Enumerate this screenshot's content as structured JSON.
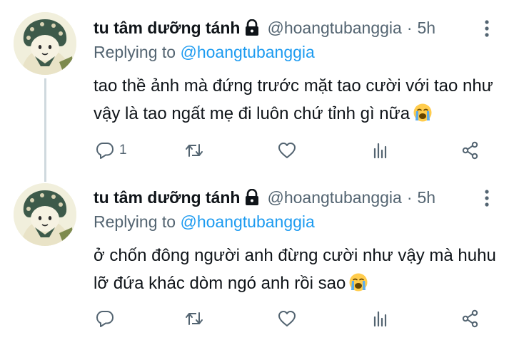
{
  "tweets": [
    {
      "display_name": "tu tâm dưỡng tánh",
      "handle": "@hoangtubanggia",
      "separator": "·",
      "time": "5h",
      "replying_prefix": "Replying to",
      "replying_handle": "@hoangtubanggia",
      "text": "tao thề ảnh mà đứng trước mặt tao cười với tao như vậy là tao ngất mẹ đi luôn chứ tỉnh gì nữa",
      "emoji": "loudly-crying-face",
      "reply_count": "1"
    },
    {
      "display_name": "tu tâm dưỡng tánh",
      "handle": "@hoangtubanggia",
      "separator": "·",
      "time": "5h",
      "replying_prefix": "Replying to",
      "replying_handle": "@hoangtubanggia",
      "text": "ở chốn đông người anh đừng cười như vậy mà huhu lỡ đứa khác dòm ngó anh rồi sao",
      "emoji": "loudly-crying-face",
      "reply_count": ""
    }
  ],
  "icons": {
    "lock": "lock-icon",
    "more": "more-vertical-icon",
    "reply": "reply-icon",
    "retweet": "retweet-icon",
    "like": "heart-icon",
    "stats": "stats-icon",
    "share": "share-icon"
  },
  "colors": {
    "text": "#0f1419",
    "secondary": "#536471",
    "link": "#1d9bf0",
    "thread_line": "#cfd9de",
    "background": "#ffffff"
  }
}
